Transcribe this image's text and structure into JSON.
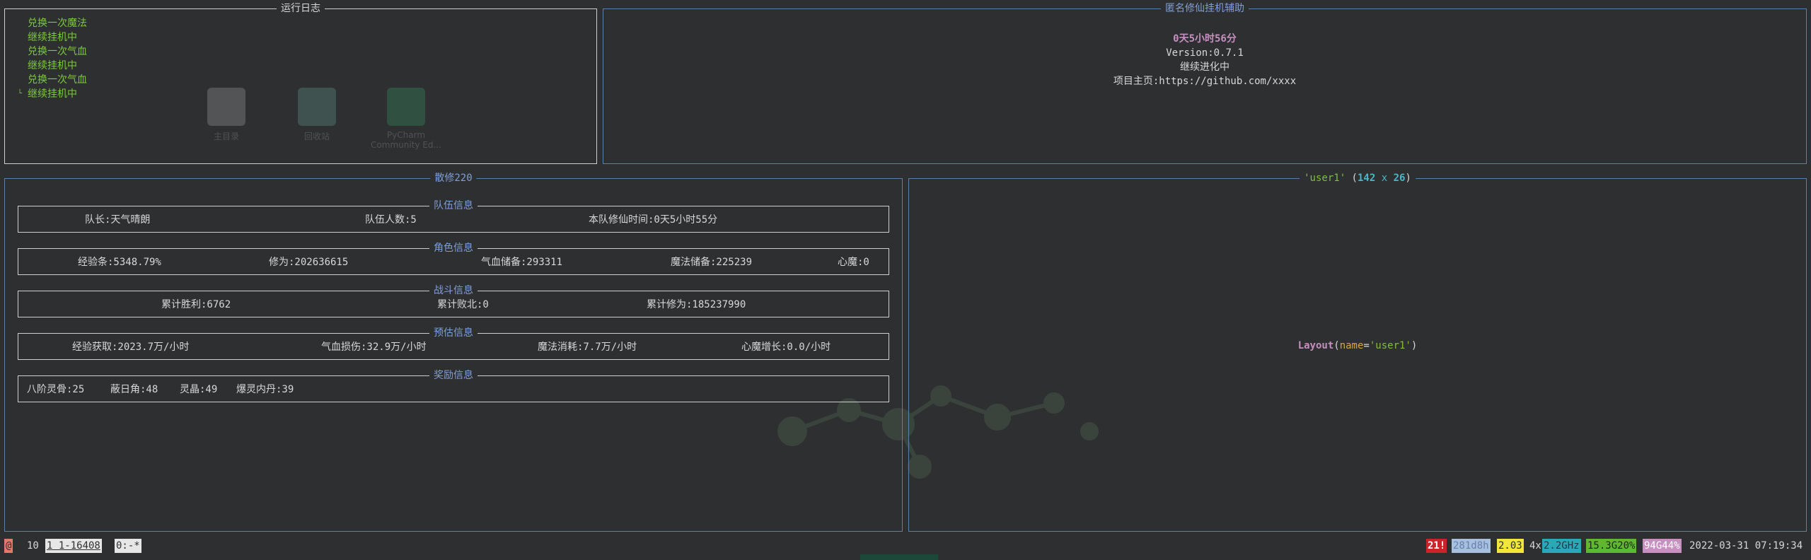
{
  "log": {
    "title": "运行日志",
    "lines": [
      "兑换一次魔法",
      "继续挂机中",
      "兑换一次气血",
      "继续挂机中",
      "兑换一次气血",
      "继续挂机中"
    ]
  },
  "desktop_icons": [
    {
      "label": "主目录",
      "icon": "folder-icon"
    },
    {
      "label": "回收站",
      "icon": "trash-icon"
    },
    {
      "label": "PyCharm Community Ed...",
      "icon": "pycharm-icon"
    }
  ],
  "info": {
    "title": "匿名修仙挂机辅助",
    "runtime": "0天5小时56分",
    "version": "Version:0.7.1",
    "status": "继续进化中",
    "homepage": "项目主页:https://github.com/xxxx"
  },
  "stats": {
    "title": "散修220",
    "team": {
      "title": "队伍信息",
      "leader": "队长:天气晴朗",
      "count": "队伍人数:5",
      "time": "本队修仙时间:0天5小时55分"
    },
    "role": {
      "title": "角色信息",
      "exp": "经验条:5348.79%",
      "cultivation": "修为:202636615",
      "hp": "气血储备:293311",
      "mp": "魔法储备:225239",
      "demon": "心魔:0"
    },
    "battle": {
      "title": "战斗信息",
      "wins": "累计胜利:6762",
      "losses": "累计败北:0",
      "total": "累计修为:185237990"
    },
    "estimate": {
      "title": "预估信息",
      "exp": "经验获取:2023.7万/小时",
      "hp": "气血损伤:32.9万/小时",
      "mp": "魔法消耗:7.7万/小时",
      "demon": "心魔增长:0.0/小时"
    },
    "reward": {
      "title": "奖励信息",
      "bone": "八阶灵骨:25",
      "horn": "蔽日角:48",
      "crystal": "灵晶:49",
      "pill": "爆灵内丹:39"
    }
  },
  "layout_panel": {
    "title_name": "'user1'",
    "paren_open": " (",
    "width": "142",
    "times": " x ",
    "height": "26",
    "paren_close": ")",
    "fn": "Layout",
    "open": "(",
    "kw": "name",
    "eq": "=",
    "str": "'user1'",
    "close": ")"
  },
  "statusbar": {
    "left": [
      {
        "text": "@",
        "bg": "#e07a6a",
        "fg": "#2e2f31"
      },
      {
        "text": "10",
        "bg": "",
        "fg": "#d8d8d8"
      },
      {
        "text": "1 1-16408",
        "bg": "#e6e6e6",
        "fg": "#2e2f31"
      },
      {
        "text": "0:-*",
        "bg": "#e6e6e6",
        "fg": "#2e2f31"
      }
    ],
    "right": [
      {
        "text": "21!",
        "bg": "#c8242a",
        "fg": "#ffffff"
      },
      {
        "text": "281d8h",
        "bg": "#a8c0e0",
        "fg": "#6a7fa8"
      },
      {
        "text": "2.03",
        "bg": "#f2e63a",
        "fg": "#2e2f31"
      },
      {
        "text": "4x",
        "bg": "",
        "fg": "#d8d8d8"
      },
      {
        "text": "2.2GHz",
        "bg": "#2aa8b8",
        "fg": "#1a3a4a"
      },
      {
        "text": "15.3G20%",
        "bg": "#5fb832",
        "fg": "#1a2a10"
      },
      {
        "text": "94G44%",
        "bg": "#c890c0",
        "fg": "#ffffff"
      },
      {
        "text": "2022-03-31 07:19:34",
        "bg": "",
        "fg": "#d8d8d8"
      }
    ]
  }
}
